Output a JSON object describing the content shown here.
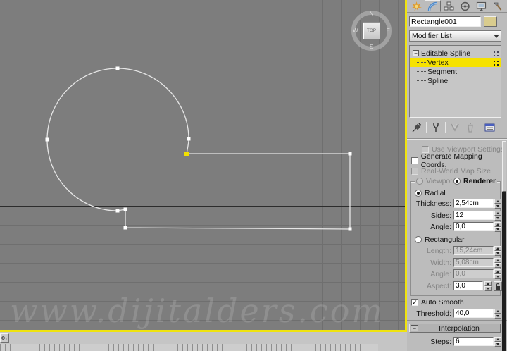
{
  "viewport": {
    "viewcube": {
      "face_label": "TOP",
      "north": "N",
      "east": "E",
      "south": "S",
      "west": "W"
    },
    "watermark": "www.dijitalders.com",
    "colors": {
      "background": "#7d7d7d",
      "grid_line": "#6f6f6f",
      "axis_line": "#2c2c2c",
      "active_border": "#efe30f",
      "spline": "#e6e6e6",
      "vertex": "#ffffff",
      "selected_vertex": "#f2e100"
    }
  },
  "track_bar": {
    "button_icon": "mini-curve-editor-icon"
  },
  "panel": {
    "tabs": [
      {
        "name": "create",
        "icon": "sunburst-icon",
        "active": false
      },
      {
        "name": "modify",
        "icon": "bend-arc-icon",
        "active": true
      },
      {
        "name": "hierarchy",
        "icon": "linked-boxes-icon",
        "active": false
      },
      {
        "name": "motion",
        "icon": "wheel-icon",
        "active": false
      },
      {
        "name": "display",
        "icon": "monitor-icon",
        "active": false
      },
      {
        "name": "utilities",
        "icon": "hammer-icon",
        "active": false
      }
    ],
    "object_name": "Rectangle001",
    "object_color": "#d9cc8e",
    "modifier_list": {
      "label": "Modifier List"
    },
    "stack": {
      "items": [
        {
          "label": "Editable Spline",
          "expand_glyph": "−",
          "selected": false
        },
        {
          "label": "Vertex",
          "selected": true
        },
        {
          "label": "Segment",
          "selected": false
        },
        {
          "label": "Spline",
          "selected": false
        }
      ]
    },
    "stack_toolbar": [
      {
        "icon": "pin-stack-icon"
      },
      {
        "icon": "show-end-result-icon"
      },
      {
        "icon": "make-unique-icon",
        "disabled": true
      },
      {
        "icon": "remove-modifier-icon",
        "disabled": true
      },
      {
        "icon": "configure-modifier-sets-icon"
      }
    ],
    "rendering": {
      "use_viewport_settings": "Use Viewport Settings",
      "generate_mapping_coords": "Generate Mapping Coords.",
      "real_world_map_size": "Real-World Map Size",
      "viewport_label": "Viewport",
      "renderer_label": "Renderer",
      "radial_label": "Radial",
      "thickness_label": "Thickness:",
      "thickness_value": "2,54cm",
      "sides_label": "Sides:",
      "sides_value": "12",
      "angle_label": "Angle:",
      "angle_value": "0,0",
      "rectangular_label": "Rectangular",
      "length_label": "Length:",
      "length_value": "15,24cm",
      "width_label": "Width:",
      "width_value": "5,08cm",
      "angle2_label": "Angle:",
      "angle2_value": "0,0",
      "aspect_label": "Aspect:",
      "aspect_value": "3,0",
      "auto_smooth_label": "Auto Smooth",
      "threshold_label": "Threshold:",
      "threshold_value": "40,0"
    },
    "interpolation": {
      "title": "Interpolation",
      "collapse_glyph": "−",
      "steps_label": "Steps:",
      "steps_value": "6"
    },
    "glyphs": {
      "check": "✓"
    }
  }
}
